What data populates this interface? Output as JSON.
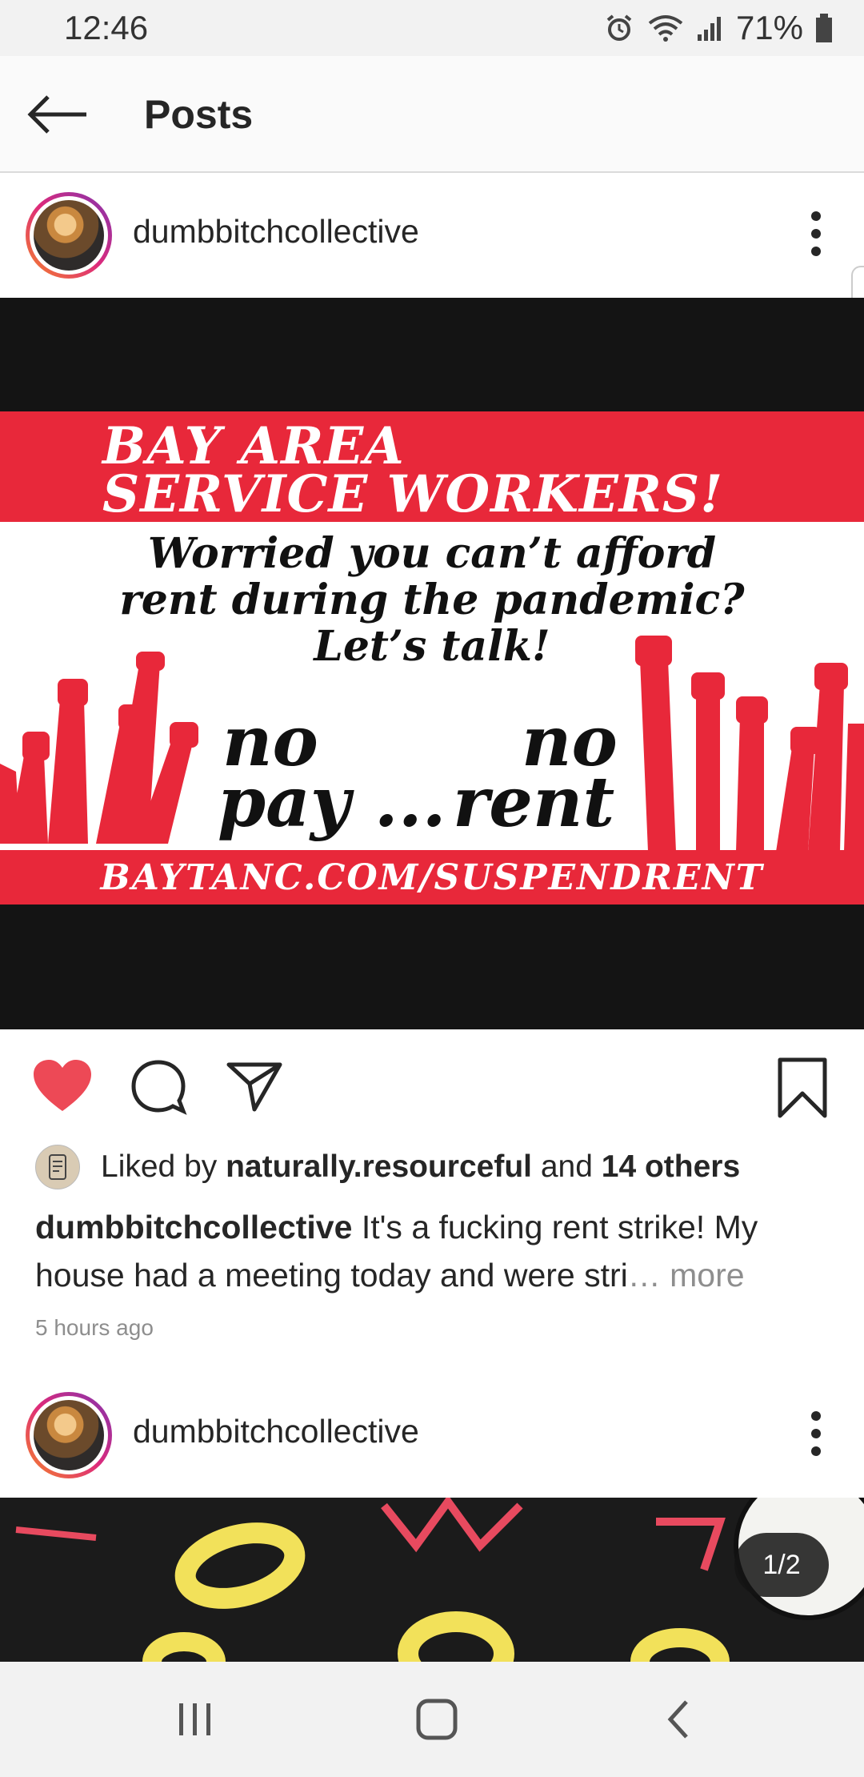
{
  "status_bar": {
    "time": "12:46",
    "battery": "71%"
  },
  "app_bar": {
    "title": "Posts"
  },
  "post1": {
    "username": "dumbbitchcollective",
    "banner": {
      "line1": "BAY AREA",
      "line2": "SERVICE WORKERS!",
      "line3": "Worried you can’t afford",
      "line4": "rent during the pandemic?",
      "line5": "Let’s talk!",
      "no1": "no",
      "pay": "pay ...",
      "no2": "no",
      "rent": "rent",
      "url": "BAYTANC.COM/SUSPENDRENT"
    },
    "liked": true,
    "likes_prefix": "Liked by ",
    "liker": "naturally.resourceful",
    "likes_mid": " and ",
    "likes_others": "14 others",
    "caption_user": "dumbbitchcollective",
    "caption_text": " It's a fucking rent strike! My house had a meeting today and were stri",
    "caption_ellipsis": "…",
    "caption_more": " more",
    "time_ago": "5 hours ago"
  },
  "post2": {
    "username": "dumbbitchcollective",
    "carousel_counter": "1/2"
  },
  "colors": {
    "like_red": "#ed4956",
    "poster_red": "#e8283a"
  },
  "icons": [
    "back-arrow-icon",
    "more-vertical-icon",
    "heart-icon",
    "comment-icon",
    "share-icon",
    "bookmark-icon",
    "recents-icon",
    "home-icon",
    "back-icon"
  ]
}
